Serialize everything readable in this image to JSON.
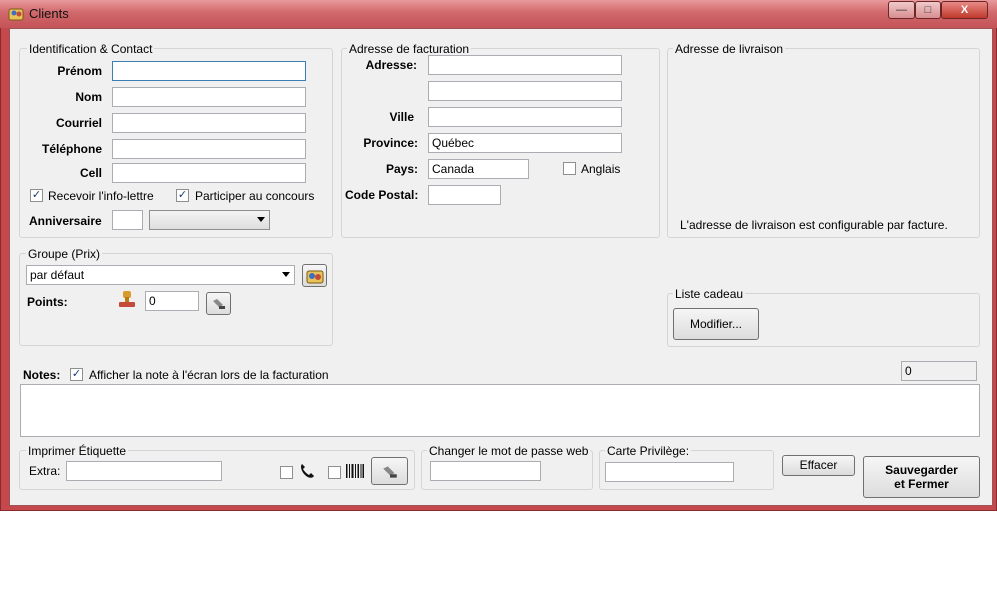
{
  "window": {
    "title": "Clients",
    "minimize": "—",
    "maximize": "□",
    "close": "X"
  },
  "identification": {
    "title": "Identification & Contact",
    "prenom_label": "Prénom",
    "nom_label": "Nom",
    "courriel_label": "Courriel",
    "telephone_label": "Téléphone",
    "cell_label": "Cell",
    "infolettre_label": "Recevoir l'info-lettre",
    "infolettre_checked": true,
    "concours_label": "Participer au concours",
    "concours_checked": true,
    "anniversaire_label": "Anniversaire"
  },
  "facturation": {
    "title": "Adresse de facturation",
    "adresse_label": "Adresse:",
    "ville_label": "Ville",
    "province_label": "Province:",
    "province_value": "Québec",
    "pays_label": "Pays:",
    "pays_value": "Canada",
    "anglais_label": "Anglais",
    "anglais_checked": false,
    "code_postal_label": "Code Postal:"
  },
  "livraison": {
    "title": "Adresse de livraison",
    "info": "L'adresse de livraison est configurable par facture."
  },
  "groupe": {
    "title": "Groupe (Prix)",
    "selected": "par défaut",
    "points_label": "Points:",
    "points_value": "0"
  },
  "liste_cadeau": {
    "title": "Liste cadeau",
    "modifier_label": "Modifier..."
  },
  "notes": {
    "label": "Notes:",
    "afficher_label": "Afficher la note à l'écran lors de la facturation",
    "afficher_checked": true,
    "counter": "0"
  },
  "etiquette": {
    "title": "Imprimer Étiquette",
    "extra_label": "Extra:"
  },
  "mot_de_passe": {
    "title": "Changer le mot de passe web"
  },
  "carte": {
    "title": "Carte Privilège:"
  },
  "actions": {
    "effacer_label": "Effacer",
    "save_line1": "Sauvegarder",
    "save_line2": "et Fermer"
  },
  "colors": {
    "window_frame": "#c5484c",
    "client_bg": "#f0f0f0",
    "focus_border": "#3c7fb1"
  }
}
